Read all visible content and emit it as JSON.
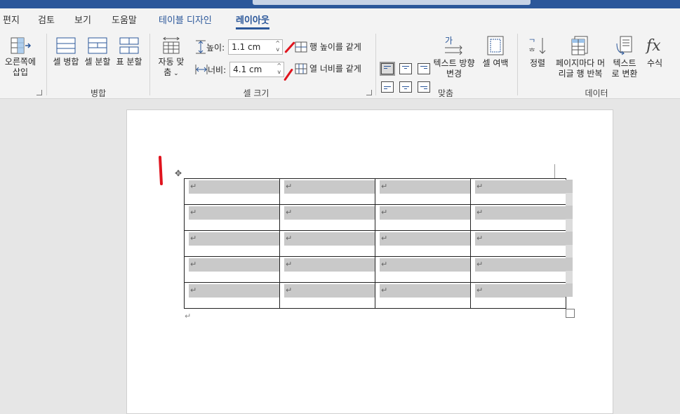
{
  "tabs": [
    {
      "label": "편지"
    },
    {
      "label": "검토"
    },
    {
      "label": "보기"
    },
    {
      "label": "도움말"
    },
    {
      "label": "테이블 디자인"
    },
    {
      "label": "레이아웃"
    }
  ],
  "ribbon": {
    "rows_cols": {
      "insert_right_line1": "오른쪽에",
      "insert_right_line2": "삽입"
    },
    "merge": {
      "merge_cells": "셀 병합",
      "split_cells": "셀 분할",
      "split_table": "표 분할",
      "group": "병합"
    },
    "cell_size": {
      "autofit_line1": "자동 맞",
      "autofit_line2": "춤",
      "height_label": "높이:",
      "height_value": "1.1 cm",
      "width_label": "너비:",
      "width_value": "4.1 cm",
      "distribute_rows": "행 높이를 같게",
      "distribute_cols": "열 너비를 같게",
      "group": "셀 크기"
    },
    "alignment": {
      "text_direction_line1": "텍스트 방향",
      "text_direction_line2": "변경",
      "cell_margins": "셀 여백",
      "group": "맞춤"
    },
    "data": {
      "sort": "정렬",
      "repeat_header_line1": "페이지마다 머",
      "repeat_header_line2": "리글 행 반복",
      "convert_line1": "텍스트",
      "convert_line2": "로 변환",
      "formula": "수식",
      "group": "데이터"
    }
  },
  "table": {
    "rows": 5,
    "cols": 4
  },
  "colors": {
    "accent": "#2b579a",
    "ink": "#e0141e",
    "cell_shading": "#c9c9c9"
  }
}
